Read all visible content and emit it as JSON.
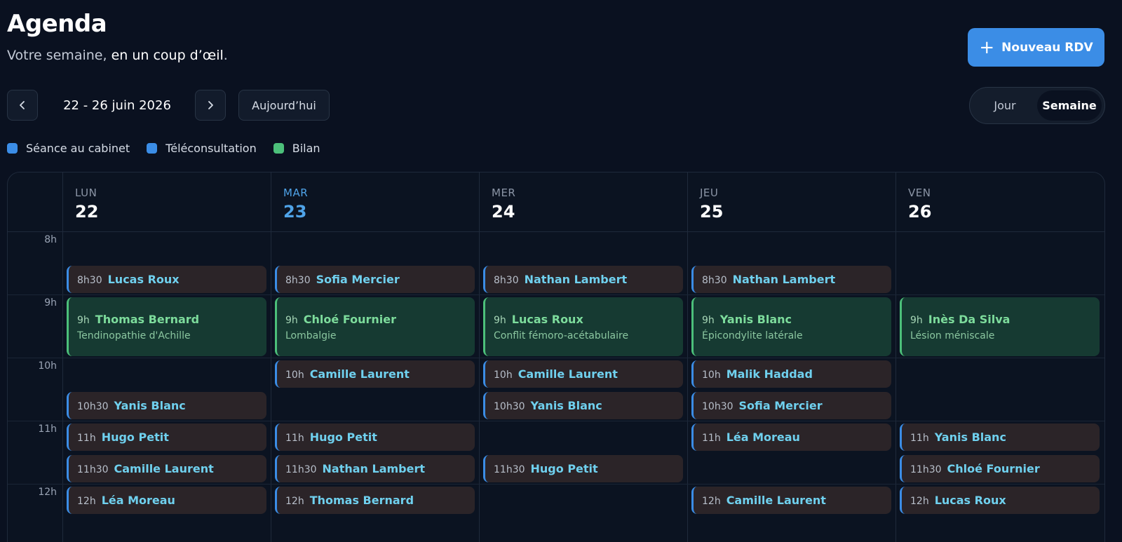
{
  "header": {
    "title": "Agenda",
    "subtitle_lead": "Votre semaine, ",
    "subtitle_strong": "en un coup d’œil",
    "subtitle_end": ".",
    "new_button_label": "Nouveau RDV"
  },
  "toolbar": {
    "week_label": "22 - 26 juin 2026",
    "today_label": "Aujourd’hui",
    "view_day": "Jour",
    "view_week": "Semaine",
    "active_view": "Semaine"
  },
  "legend": [
    {
      "label": "Séance au cabinet",
      "color": "#3b8de6"
    },
    {
      "label": "Téléconsultation",
      "color": "#3b8de6"
    },
    {
      "label": "Bilan",
      "color": "#4cc07a"
    }
  ],
  "colors": {
    "accent": "#3b8de6",
    "today": "#4fa3e8",
    "bilan": "#4cc07a"
  },
  "hours": [
    "8h",
    "9h",
    "10h",
    "11h",
    "12h"
  ],
  "days": [
    {
      "name": "LUN",
      "num": "22",
      "today": false
    },
    {
      "name": "MAR",
      "num": "23",
      "today": true
    },
    {
      "name": "MER",
      "num": "24",
      "today": false
    },
    {
      "name": "JEU",
      "num": "25",
      "today": false
    },
    {
      "name": "VEN",
      "num": "26",
      "today": false
    }
  ],
  "appointments": [
    {
      "day": 0,
      "start": 8.5,
      "time": "8h30",
      "name": "Lucas Roux",
      "kind": "seance"
    },
    {
      "day": 0,
      "start": 9,
      "time": "9h",
      "name": "Thomas Bernard",
      "detail": "Tendinopathie d'Achille",
      "kind": "bilan"
    },
    {
      "day": 0,
      "start": 10.5,
      "time": "10h30",
      "name": "Yanis Blanc",
      "kind": "seance"
    },
    {
      "day": 0,
      "start": 11,
      "time": "11h",
      "name": "Hugo Petit",
      "kind": "seance"
    },
    {
      "day": 0,
      "start": 11.5,
      "time": "11h30",
      "name": "Camille Laurent",
      "kind": "seance"
    },
    {
      "day": 0,
      "start": 12,
      "time": "12h",
      "name": "Léa Moreau",
      "kind": "seance"
    },
    {
      "day": 1,
      "start": 8.5,
      "time": "8h30",
      "name": "Sofia Mercier",
      "kind": "seance"
    },
    {
      "day": 1,
      "start": 9,
      "time": "9h",
      "name": "Chloé Fournier",
      "detail": "Lombalgie",
      "kind": "bilan"
    },
    {
      "day": 1,
      "start": 10,
      "time": "10h",
      "name": "Camille Laurent",
      "kind": "seance"
    },
    {
      "day": 1,
      "start": 11,
      "time": "11h",
      "name": "Hugo Petit",
      "kind": "seance"
    },
    {
      "day": 1,
      "start": 11.5,
      "time": "11h30",
      "name": "Nathan Lambert",
      "kind": "seance"
    },
    {
      "day": 1,
      "start": 12,
      "time": "12h",
      "name": "Thomas Bernard",
      "kind": "seance"
    },
    {
      "day": 2,
      "start": 8.5,
      "time": "8h30",
      "name": "Nathan Lambert",
      "kind": "seance"
    },
    {
      "day": 2,
      "start": 9,
      "time": "9h",
      "name": "Lucas Roux",
      "detail": "Conflit fémoro-acétabulaire",
      "kind": "bilan"
    },
    {
      "day": 2,
      "start": 10,
      "time": "10h",
      "name": "Camille Laurent",
      "kind": "seance"
    },
    {
      "day": 2,
      "start": 10.5,
      "time": "10h30",
      "name": "Yanis Blanc",
      "kind": "seance"
    },
    {
      "day": 2,
      "start": 11.5,
      "time": "11h30",
      "name": "Hugo Petit",
      "kind": "seance"
    },
    {
      "day": 3,
      "start": 8.5,
      "time": "8h30",
      "name": "Nathan Lambert",
      "kind": "seance"
    },
    {
      "day": 3,
      "start": 9,
      "time": "9h",
      "name": "Yanis Blanc",
      "detail": "Épicondylite latérale",
      "kind": "bilan"
    },
    {
      "day": 3,
      "start": 10,
      "time": "10h",
      "name": "Malik Haddad",
      "kind": "seance"
    },
    {
      "day": 3,
      "start": 10.5,
      "time": "10h30",
      "name": "Sofia Mercier",
      "kind": "seance"
    },
    {
      "day": 3,
      "start": 11,
      "time": "11h",
      "name": "Léa Moreau",
      "kind": "seance"
    },
    {
      "day": 3,
      "start": 12,
      "time": "12h",
      "name": "Camille Laurent",
      "kind": "seance"
    },
    {
      "day": 4,
      "start": 9,
      "time": "9h",
      "name": "Inès Da Silva",
      "detail": "Lésion méniscale",
      "kind": "bilan"
    },
    {
      "day": 4,
      "start": 11,
      "time": "11h",
      "name": "Yanis Blanc",
      "kind": "seance"
    },
    {
      "day": 4,
      "start": 11.5,
      "time": "11h30",
      "name": "Chloé Fournier",
      "kind": "seance"
    },
    {
      "day": 4,
      "start": 12,
      "time": "12h",
      "name": "Lucas Roux",
      "kind": "seance"
    }
  ],
  "icons": {
    "prev": "chevron-left-icon",
    "next": "chevron-right-icon",
    "add": "plus-icon"
  }
}
